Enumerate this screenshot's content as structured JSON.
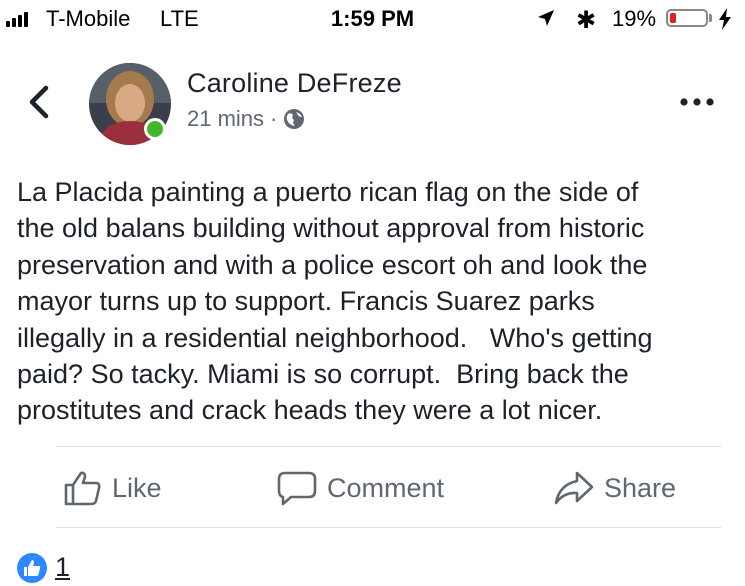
{
  "status_bar": {
    "carrier": "T-Mobile",
    "network": "LTE",
    "time": "1:59 PM",
    "battery_percent": "19%",
    "battery_level": 0.19,
    "battery_color": "#e02020"
  },
  "post": {
    "author": "Caroline DeFreze",
    "time_ago": "21 mins",
    "separator": "·",
    "privacy_icon": "globe-icon",
    "online_status_color": "#42b72a",
    "text": "La Placida painting a puerto rican flag on the side of\nthe old balans building without approval from historic\npreservation and with a police escort oh and look the\nmayor turns up to support. Francis Suarez parks\nillegally in a residential neighborhood.   Who's getting\npaid? So tacky. Miami is so corrupt.  Bring back the\nprostitutes and crack heads they were a lot nicer."
  },
  "actions": {
    "like_label": "Like",
    "comment_label": "Comment",
    "share_label": "Share"
  },
  "reactions": {
    "count": "1",
    "icon": "thumbs-up-icon",
    "badge_color": "#2d88ff"
  }
}
